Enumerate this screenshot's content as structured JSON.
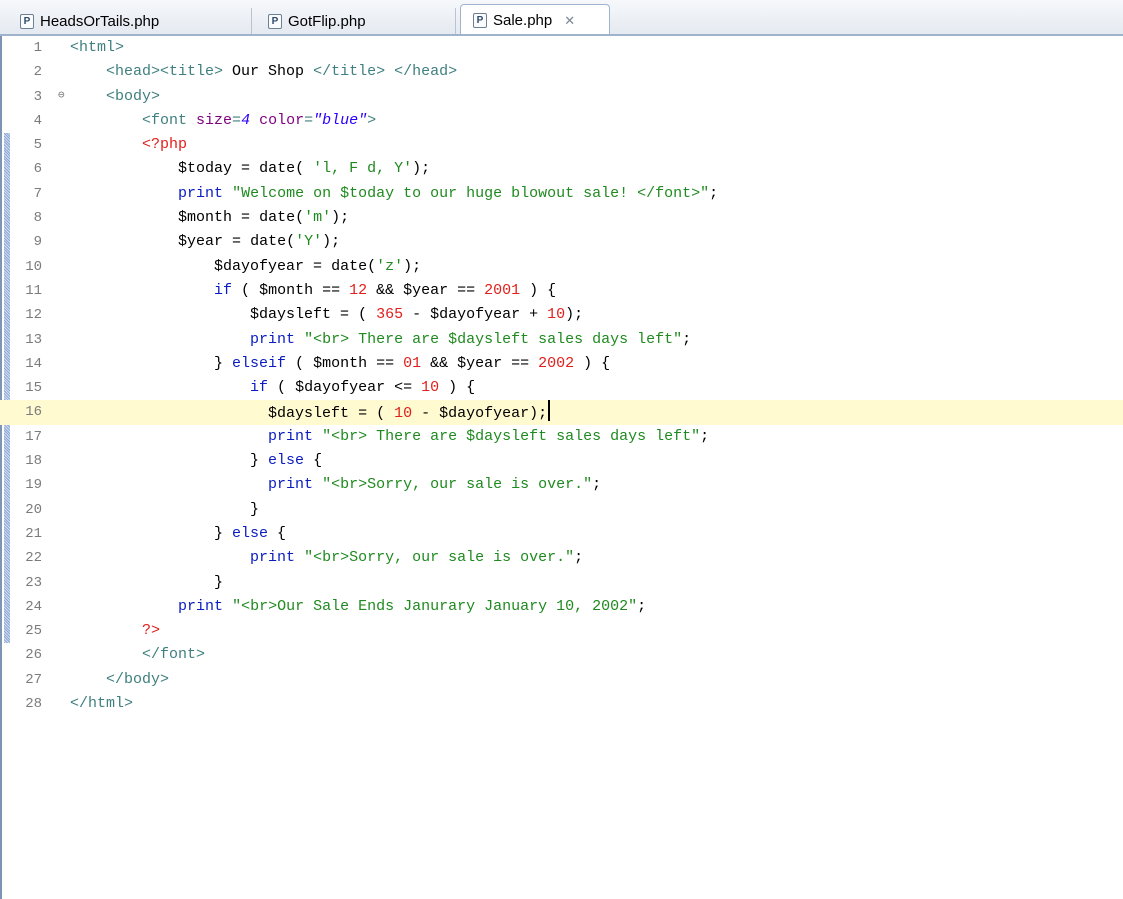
{
  "tabs": [
    {
      "label": "HeadsOrTails.php",
      "icon": "php-file-icon",
      "icon_glyph": "P",
      "active": false
    },
    {
      "label": "GotFlip.php",
      "icon": "php-file-icon",
      "icon_glyph": "P",
      "active": false
    },
    {
      "label": "Sale.php",
      "icon": "php-file-icon",
      "icon_glyph": "P",
      "active": true,
      "close_glyph": "✕"
    }
  ],
  "editor": {
    "current_line": 16,
    "change_bar_lines": [
      5,
      25
    ],
    "folded_line": 3,
    "fold_glyph": "⊖",
    "lines": [
      {
        "n": "1",
        "tokens": [
          {
            "t": "tg",
            "s": "<html>"
          }
        ]
      },
      {
        "n": "2",
        "tokens": [
          {
            "t": "op",
            "s": "    "
          },
          {
            "t": "tg",
            "s": "<head><title>"
          },
          {
            "t": "op",
            "s": " Our Shop "
          },
          {
            "t": "tg",
            "s": "</title>"
          },
          {
            "t": "op",
            "s": " "
          },
          {
            "t": "tg",
            "s": "</head>"
          }
        ]
      },
      {
        "n": "3",
        "tokens": [
          {
            "t": "op",
            "s": "    "
          },
          {
            "t": "tg",
            "s": "<body>"
          }
        ]
      },
      {
        "n": "4",
        "tokens": [
          {
            "t": "op",
            "s": "        "
          },
          {
            "t": "tg",
            "s": "<font "
          },
          {
            "t": "at",
            "s": "size"
          },
          {
            "t": "tg",
            "s": "="
          },
          {
            "t": "av",
            "s": "4"
          },
          {
            "t": "tg",
            "s": " "
          },
          {
            "t": "at",
            "s": "color"
          },
          {
            "t": "tg",
            "s": "="
          },
          {
            "t": "av",
            "s": "\"blue\""
          },
          {
            "t": "tg",
            "s": ">"
          }
        ]
      },
      {
        "n": "5",
        "tokens": [
          {
            "t": "op",
            "s": "        "
          },
          {
            "t": "ph",
            "s": "<?php"
          }
        ]
      },
      {
        "n": "6",
        "tokens": [
          {
            "t": "op",
            "s": "            "
          },
          {
            "t": "vr",
            "s": "$today"
          },
          {
            "t": "op",
            "s": " = "
          },
          {
            "t": "fn",
            "s": "date"
          },
          {
            "t": "op",
            "s": "( "
          },
          {
            "t": "st",
            "s": "'l, F d, Y'"
          },
          {
            "t": "op",
            "s": ");"
          }
        ]
      },
      {
        "n": "7",
        "tokens": [
          {
            "t": "op",
            "s": "            "
          },
          {
            "t": "kw",
            "s": "print"
          },
          {
            "t": "op",
            "s": " "
          },
          {
            "t": "st",
            "s": "\"Welcome on $today to our huge blowout sale! </font>\""
          },
          {
            "t": "op",
            "s": ";"
          }
        ]
      },
      {
        "n": "8",
        "tokens": [
          {
            "t": "op",
            "s": "            "
          },
          {
            "t": "vr",
            "s": "$month"
          },
          {
            "t": "op",
            "s": " = "
          },
          {
            "t": "fn",
            "s": "date"
          },
          {
            "t": "op",
            "s": "("
          },
          {
            "t": "st",
            "s": "'m'"
          },
          {
            "t": "op",
            "s": ");"
          }
        ]
      },
      {
        "n": "9",
        "tokens": [
          {
            "t": "op",
            "s": "            "
          },
          {
            "t": "vr",
            "s": "$year"
          },
          {
            "t": "op",
            "s": " = "
          },
          {
            "t": "fn",
            "s": "date"
          },
          {
            "t": "op",
            "s": "("
          },
          {
            "t": "st",
            "s": "'Y'"
          },
          {
            "t": "op",
            "s": ");"
          }
        ]
      },
      {
        "n": "10",
        "tokens": [
          {
            "t": "op",
            "s": "                "
          },
          {
            "t": "vr",
            "s": "$dayofyear"
          },
          {
            "t": "op",
            "s": " = "
          },
          {
            "t": "fn",
            "s": "date"
          },
          {
            "t": "op",
            "s": "("
          },
          {
            "t": "st",
            "s": "'z'"
          },
          {
            "t": "op",
            "s": ");"
          }
        ]
      },
      {
        "n": "11",
        "tokens": [
          {
            "t": "op",
            "s": "                "
          },
          {
            "t": "kw",
            "s": "if"
          },
          {
            "t": "op",
            "s": " ( "
          },
          {
            "t": "vr",
            "s": "$month"
          },
          {
            "t": "op",
            "s": " == "
          },
          {
            "t": "nm",
            "s": "12"
          },
          {
            "t": "op",
            "s": " && "
          },
          {
            "t": "vr",
            "s": "$year"
          },
          {
            "t": "op",
            "s": " == "
          },
          {
            "t": "nm",
            "s": "2001"
          },
          {
            "t": "op",
            "s": " ) {"
          }
        ]
      },
      {
        "n": "12",
        "tokens": [
          {
            "t": "op",
            "s": "                    "
          },
          {
            "t": "vr",
            "s": "$daysleft"
          },
          {
            "t": "op",
            "s": " = ( "
          },
          {
            "t": "nm",
            "s": "365"
          },
          {
            "t": "op",
            "s": " - "
          },
          {
            "t": "vr",
            "s": "$dayofyear"
          },
          {
            "t": "op",
            "s": " + "
          },
          {
            "t": "nm",
            "s": "10"
          },
          {
            "t": "op",
            "s": ");"
          }
        ]
      },
      {
        "n": "13",
        "tokens": [
          {
            "t": "op",
            "s": "                    "
          },
          {
            "t": "kw",
            "s": "print"
          },
          {
            "t": "op",
            "s": " "
          },
          {
            "t": "st",
            "s": "\"<br> There are $daysleft sales days left\""
          },
          {
            "t": "op",
            "s": ";"
          }
        ]
      },
      {
        "n": "14",
        "tokens": [
          {
            "t": "op",
            "s": "                } "
          },
          {
            "t": "kw",
            "s": "elseif"
          },
          {
            "t": "op",
            "s": " ( "
          },
          {
            "t": "vr",
            "s": "$month"
          },
          {
            "t": "op",
            "s": " == "
          },
          {
            "t": "nm",
            "s": "01"
          },
          {
            "t": "op",
            "s": " && "
          },
          {
            "t": "vr",
            "s": "$year"
          },
          {
            "t": "op",
            "s": " == "
          },
          {
            "t": "nm",
            "s": "2002"
          },
          {
            "t": "op",
            "s": " ) {"
          }
        ]
      },
      {
        "n": "15",
        "tokens": [
          {
            "t": "op",
            "s": "                    "
          },
          {
            "t": "kw",
            "s": "if"
          },
          {
            "t": "op",
            "s": " ( "
          },
          {
            "t": "vr",
            "s": "$dayofyear"
          },
          {
            "t": "op",
            "s": " <= "
          },
          {
            "t": "nm",
            "s": "10"
          },
          {
            "t": "op",
            "s": " ) {"
          }
        ]
      },
      {
        "n": "16",
        "tokens": [
          {
            "t": "op",
            "s": "                      "
          },
          {
            "t": "vr",
            "s": "$daysleft"
          },
          {
            "t": "op",
            "s": " = ( "
          },
          {
            "t": "nm",
            "s": "10"
          },
          {
            "t": "op",
            "s": " - "
          },
          {
            "t": "vr",
            "s": "$dayofyear"
          },
          {
            "t": "op",
            "s": ");"
          }
        ]
      },
      {
        "n": "17",
        "tokens": [
          {
            "t": "op",
            "s": "                      "
          },
          {
            "t": "kw",
            "s": "print"
          },
          {
            "t": "op",
            "s": " "
          },
          {
            "t": "st",
            "s": "\"<br> There are $daysleft sales days left\""
          },
          {
            "t": "op",
            "s": ";"
          }
        ]
      },
      {
        "n": "18",
        "tokens": [
          {
            "t": "op",
            "s": "                    } "
          },
          {
            "t": "kw",
            "s": "else"
          },
          {
            "t": "op",
            "s": " {"
          }
        ]
      },
      {
        "n": "19",
        "tokens": [
          {
            "t": "op",
            "s": "                      "
          },
          {
            "t": "kw",
            "s": "print"
          },
          {
            "t": "op",
            "s": " "
          },
          {
            "t": "st",
            "s": "\"<br>Sorry, our sale is over.\""
          },
          {
            "t": "op",
            "s": ";"
          }
        ]
      },
      {
        "n": "20",
        "tokens": [
          {
            "t": "op",
            "s": "                    }"
          }
        ]
      },
      {
        "n": "21",
        "tokens": [
          {
            "t": "op",
            "s": "                } "
          },
          {
            "t": "kw",
            "s": "else"
          },
          {
            "t": "op",
            "s": " {"
          }
        ]
      },
      {
        "n": "22",
        "tokens": [
          {
            "t": "op",
            "s": "                    "
          },
          {
            "t": "kw",
            "s": "print"
          },
          {
            "t": "op",
            "s": " "
          },
          {
            "t": "st",
            "s": "\"<br>Sorry, our sale is over.\""
          },
          {
            "t": "op",
            "s": ";"
          }
        ]
      },
      {
        "n": "23",
        "tokens": [
          {
            "t": "op",
            "s": "                }"
          }
        ]
      },
      {
        "n": "24",
        "tokens": [
          {
            "t": "op",
            "s": "            "
          },
          {
            "t": "kw",
            "s": "print"
          },
          {
            "t": "op",
            "s": " "
          },
          {
            "t": "st",
            "s": "\"<br>Our Sale Ends Janurary January 10, 2002\""
          },
          {
            "t": "op",
            "s": ";"
          }
        ]
      },
      {
        "n": "25",
        "tokens": [
          {
            "t": "op",
            "s": "        "
          },
          {
            "t": "ph",
            "s": "?>"
          }
        ]
      },
      {
        "n": "26",
        "tokens": [
          {
            "t": "op",
            "s": "        "
          },
          {
            "t": "tg",
            "s": "</font>"
          }
        ]
      },
      {
        "n": "27",
        "tokens": [
          {
            "t": "op",
            "s": "    "
          },
          {
            "t": "tg",
            "s": "</body>"
          }
        ]
      },
      {
        "n": "28",
        "tokens": [
          {
            "t": "tg",
            "s": "</html>"
          }
        ]
      }
    ]
  },
  "colors": {
    "tag": "#3f7f7f",
    "attribute": "#7f007f",
    "attr_value": "#2a00ff",
    "keyword": "#0a1cc0",
    "string": "#1f8a1f",
    "number": "#e0201c",
    "php_delimiter": "#e0201c",
    "current_line_bg": "#fffad0"
  }
}
